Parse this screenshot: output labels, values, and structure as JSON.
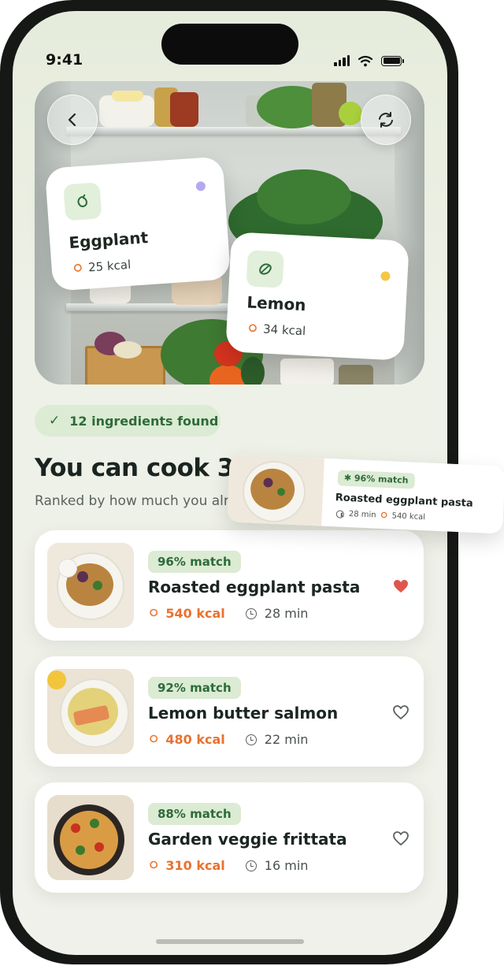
{
  "status_bar": {
    "time": "9:41"
  },
  "hero": {
    "back_icon": "chevron-left-icon",
    "refresh_icon": "refresh-icon",
    "ingredients": [
      {
        "name": "Eggplant",
        "kcal": "25 kcal",
        "icon": "eggplant-icon",
        "dot_color": "#b3a9f2"
      },
      {
        "name": "Lemon",
        "kcal": "34 kcal",
        "icon": "lemon-icon",
        "dot_color": "#f3c845"
      }
    ]
  },
  "found": {
    "label": "12 ingredients found",
    "icon": "check-icon"
  },
  "heading": {
    "title": "You can cook 3 dishes",
    "subtitle": "Ranked by how much you already have"
  },
  "recipes": [
    {
      "match": "96% match",
      "title": "Roasted eggplant pasta",
      "kcal": "540 kcal",
      "time": "28 min",
      "favorite": true
    },
    {
      "match": "92% match",
      "title": "Lemon butter salmon",
      "kcal": "480 kcal",
      "time": "22 min",
      "favorite": false
    },
    {
      "match": "88% match",
      "title": "Garden veggie frittata",
      "kcal": "310 kcal",
      "time": "16 min",
      "favorite": false
    }
  ],
  "drag_preview": {
    "match": "96% match",
    "title": "Roasted eggplant pasta",
    "time": "28 min",
    "kcal": "540 kcal"
  },
  "colors": {
    "accent_green": "#2d6b3a",
    "match_bg": "#dcebd3",
    "kcal_orange": "#e8722f",
    "heart_red": "#e0564c"
  }
}
